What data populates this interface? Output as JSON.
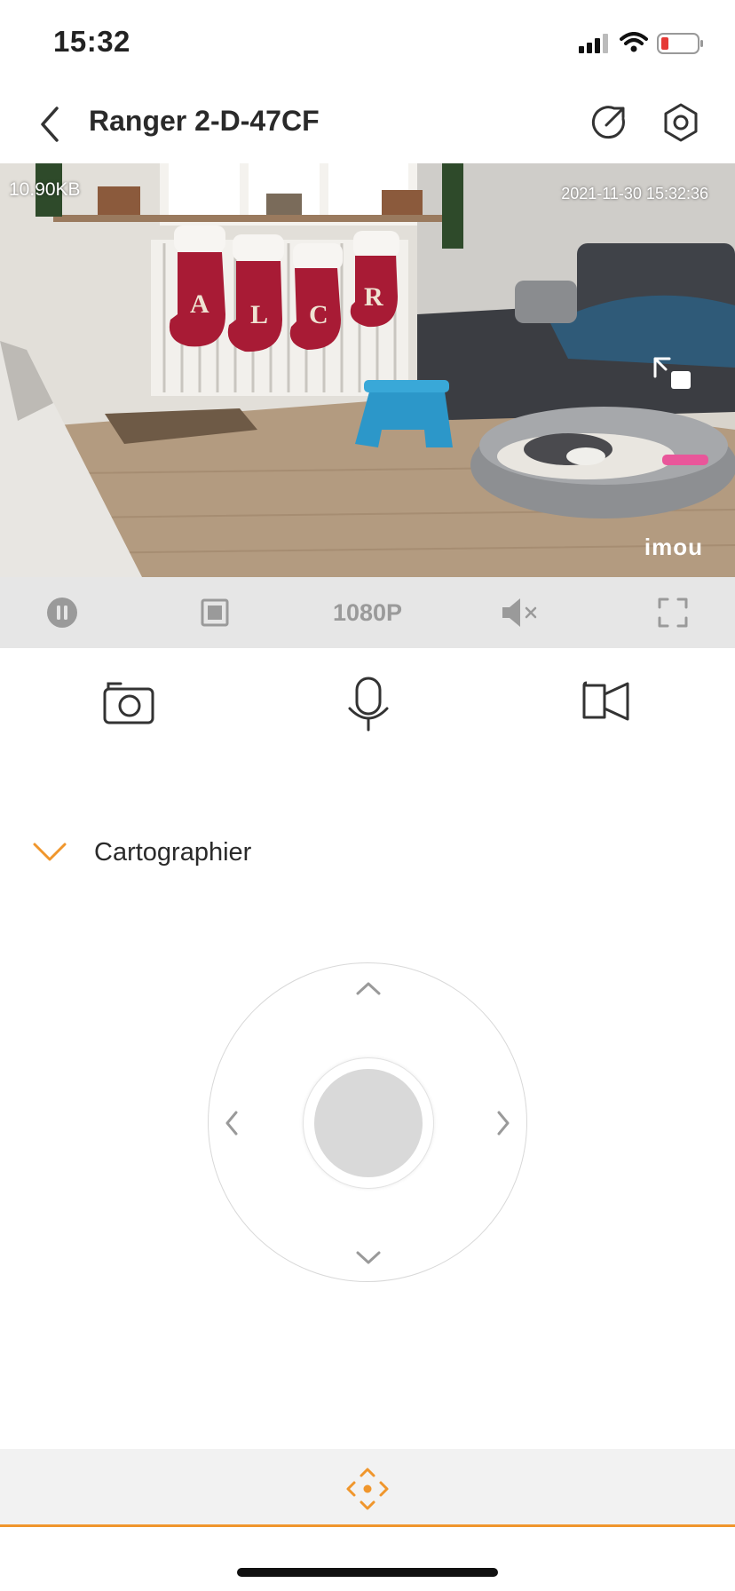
{
  "status_bar": {
    "time": "15:32"
  },
  "header": {
    "title": "Ranger 2-D-47CF"
  },
  "video": {
    "bitrate": "10.90KB",
    "timestamp": "2021-11-30 15:32:36",
    "brand": "imou",
    "stocking_letters": [
      "A",
      "L",
      "C",
      "R"
    ]
  },
  "control_bar": {
    "resolution": "1080P",
    "items": [
      "pause-icon",
      "stop-icon",
      "resolution",
      "mute-icon",
      "fullscreen-icon"
    ]
  },
  "actions": [
    "camera-icon",
    "microphone-icon",
    "video-record-icon"
  ],
  "section": {
    "label": "Cartographier",
    "accent": "#f0962c"
  },
  "joystick": {
    "arrows": [
      "up",
      "left",
      "right",
      "down"
    ]
  },
  "bottom_bar": {
    "icon": "ptz-direction-icon",
    "accent": "#f0962c"
  }
}
